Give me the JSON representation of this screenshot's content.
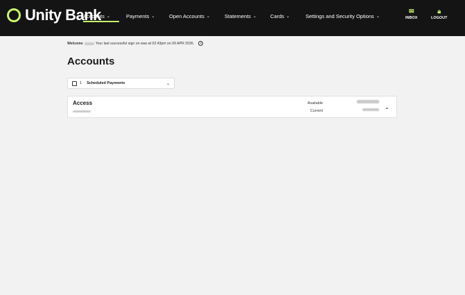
{
  "brand": {
    "name": "Unity Bank",
    "accent": "#c8f76b",
    "topbar_bg": "#141414"
  },
  "nav": [
    {
      "label": "Accounts",
      "has_dropdown": true,
      "active": true
    },
    {
      "label": "Payments",
      "has_dropdown": true
    },
    {
      "label": "Open Accounts",
      "has_dropdown": true
    },
    {
      "label": "Statements",
      "has_dropdown": true
    },
    {
      "label": "Cards",
      "has_dropdown": true
    },
    {
      "label": "Settings and Security Options",
      "has_dropdown": true
    }
  ],
  "top_actions": {
    "inbox": "INBOX",
    "logout": "LOGOUT"
  },
  "welcome": {
    "prefix": "Welcome",
    "message": "Your last successful sign on was at 02:43pm on 09 APR 2026."
  },
  "page_title": "Accounts",
  "scheduled": {
    "count": "1",
    "label": "Scheduled Payments"
  },
  "account": {
    "name": "Access",
    "available_label": "Available",
    "current_label": "Current"
  }
}
